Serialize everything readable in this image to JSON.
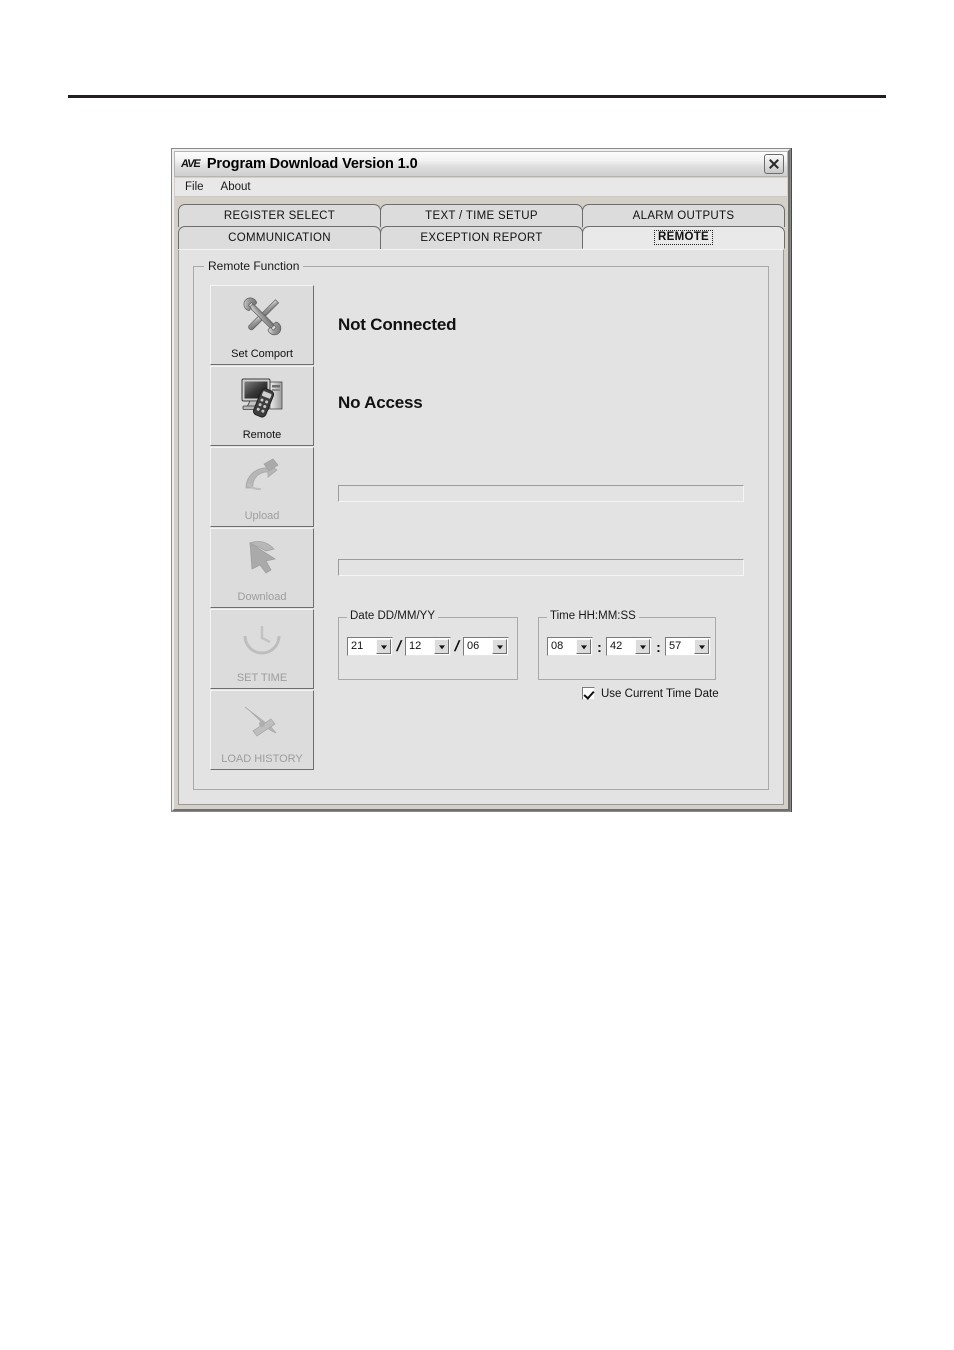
{
  "window": {
    "logo": "AVE",
    "title": "Program Download Version 1.0",
    "close_icon": "close-icon"
  },
  "menu": {
    "items": [
      {
        "label": "File"
      },
      {
        "label": "About"
      }
    ]
  },
  "tabs": {
    "row1": [
      {
        "label": "REGISTER SELECT",
        "active": false
      },
      {
        "label": "TEXT / TIME SETUP",
        "active": false
      },
      {
        "label": "ALARM OUTPUTS",
        "active": false
      }
    ],
    "row2": [
      {
        "label": "COMMUNICATION",
        "active": false
      },
      {
        "label": "EXCEPTION REPORT",
        "active": false
      },
      {
        "label": "REMOTE",
        "active": true
      }
    ]
  },
  "remote_panel": {
    "group_title": "Remote Function",
    "buttons": [
      {
        "label": "Set Comport",
        "icon": "tools-icon",
        "enabled": true
      },
      {
        "label": "Remote",
        "icon": "monitor-remote-icon",
        "enabled": true
      },
      {
        "label": "Upload",
        "icon": "upload-hand-icon",
        "enabled": false
      },
      {
        "label": "Download",
        "icon": "download-hand-icon",
        "enabled": false
      },
      {
        "label": "SET TIME",
        "icon": "clock-icon",
        "enabled": false
      },
      {
        "label": "LOAD HISTORY",
        "icon": "history-icon",
        "enabled": false
      }
    ],
    "status": {
      "connection": "Not Connected",
      "access": "No Access"
    },
    "progress": [
      {
        "value": 0
      },
      {
        "value": 0
      }
    ],
    "date": {
      "group_title": "Date DD/MM/YY",
      "day": "21",
      "month": "12",
      "year": "06",
      "separator": "/"
    },
    "time": {
      "group_title": "Time HH:MM:SS",
      "hour": "08",
      "minute": "42",
      "second": "57",
      "separator": ":"
    },
    "use_current": {
      "label": "Use Current Time Date",
      "checked": true
    }
  },
  "colors": {
    "window_face": "#d4d0c8",
    "panel_face": "#e3e3e3",
    "text": "#111111",
    "disabled_text": "#9d9d9d",
    "rule": "#231f20"
  }
}
